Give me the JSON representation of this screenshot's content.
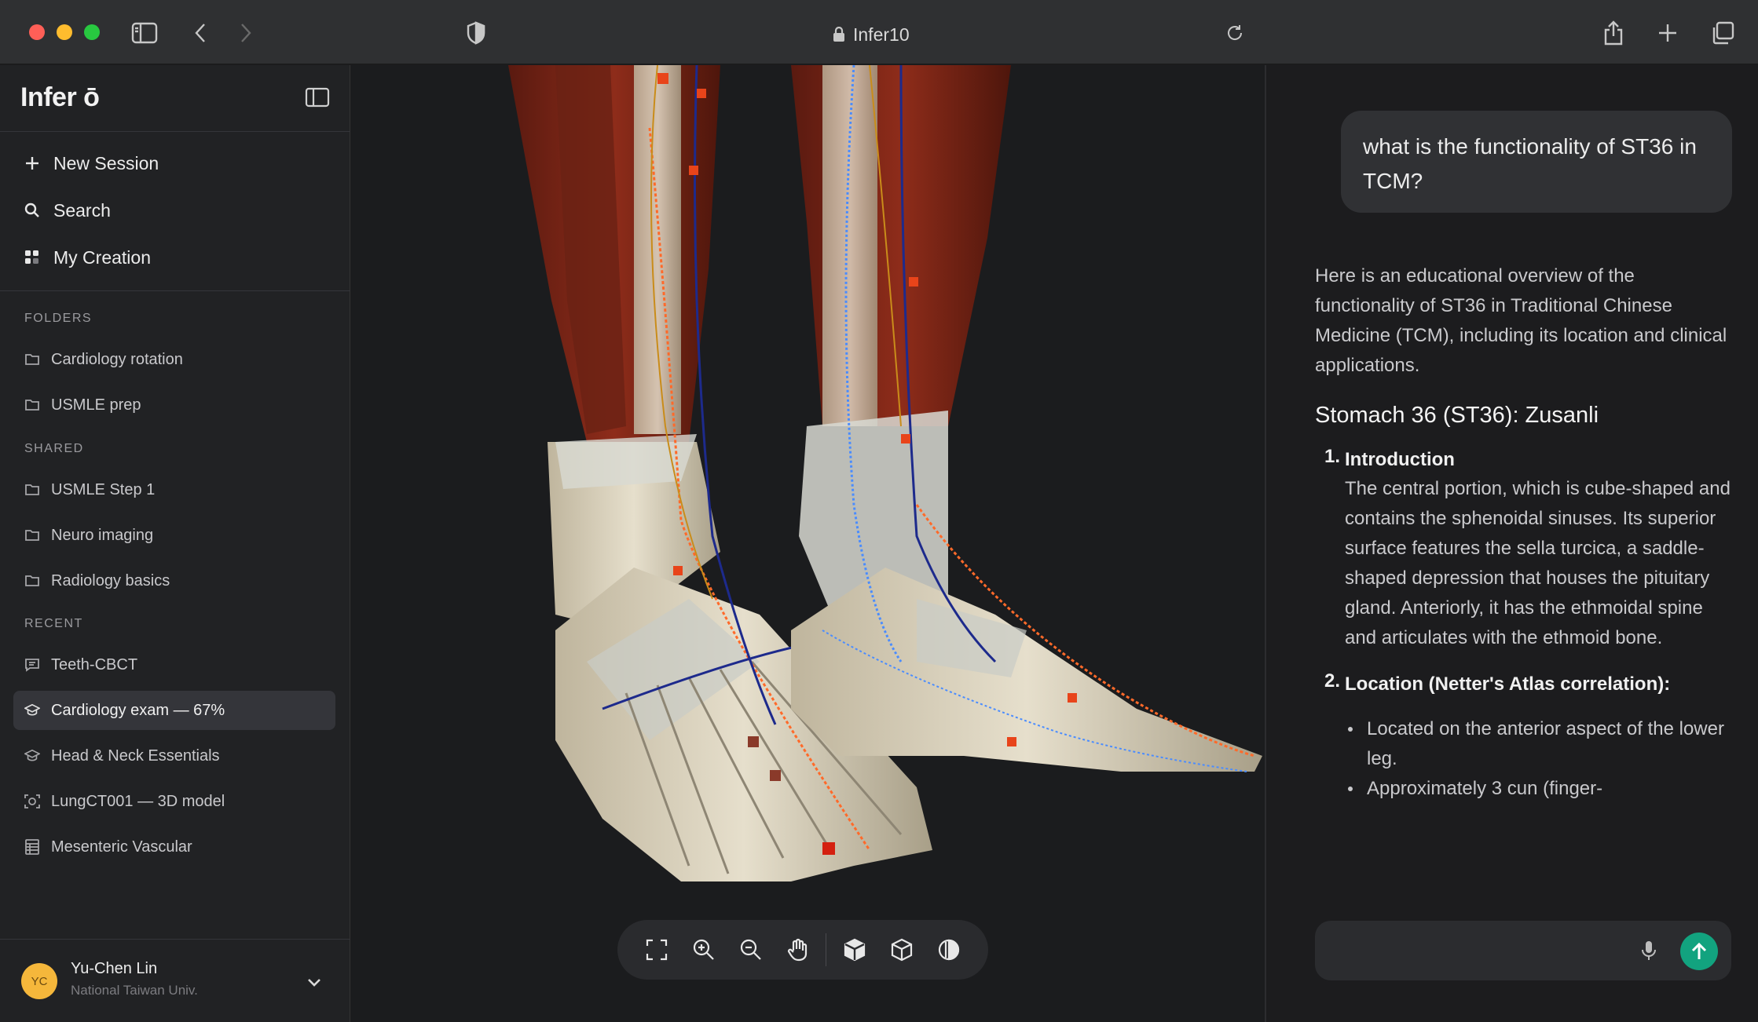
{
  "browser": {
    "url": "Infer10"
  },
  "sidebar": {
    "logo": "Infer ō",
    "actions": [
      {
        "label": "New Session",
        "icon": "plus-icon"
      },
      {
        "label": "Search",
        "icon": "search-icon"
      },
      {
        "label": "My Creation",
        "icon": "grid-icon"
      }
    ],
    "folders_heading": "FOLDERS",
    "folders": [
      "Cardiology rotation",
      "USMLE prep"
    ],
    "shared_heading": "SHARED",
    "shared": [
      "USMLE Step 1",
      "Neuro imaging",
      "Radiology basics"
    ],
    "recent_heading": "RECENT",
    "recent": [
      {
        "label": "Teeth-CBCT",
        "icon": "chat-icon"
      },
      {
        "label": "Cardiology exam — 67%",
        "icon": "graduation-cap-icon",
        "active": true
      },
      {
        "label": "Head & Neck Essentials",
        "icon": "graduation-cap-icon"
      },
      {
        "label": "LungCT001 — 3D model",
        "icon": "scan-icon"
      },
      {
        "label": "Mesenteric Vascular",
        "icon": "table-icon"
      }
    ],
    "user": {
      "initials": "YC",
      "name": "Yu-Chen Lin",
      "org": "National Taiwan Univ."
    }
  },
  "viewer": {
    "toolbar": [
      "fullscreen-icon",
      "zoom-in-icon",
      "zoom-out-icon",
      "pan-hand-icon",
      "solid-cube-icon",
      "wireframe-cube-icon",
      "contrast-icon"
    ]
  },
  "chat": {
    "user_message": "what is the functionality of ST36 in TCM?",
    "intro": "Here is an educational overview of the functionality of ST36 in Traditional Chinese Medicine (TCM), including its location and clinical applications.",
    "heading": "Stomach 36 (ST36): Zusanli",
    "items": [
      {
        "num": "1.",
        "title": "Introduction",
        "body": "The central portion, which is cube-shaped and contains the sphenoidal sinuses. Its superior surface features the sella turcica, a saddle-shaped depression that houses the pituitary gland. Anteriorly, it has the ethmoidal spine and articulates with the ethmoid bone."
      },
      {
        "num": "2.",
        "title": "Location (Netter's Atlas correlation):",
        "bullets": [
          "Located on the anterior aspect of the lower leg.",
          "Approximately 3 cun (finger-"
        ]
      }
    ]
  }
}
